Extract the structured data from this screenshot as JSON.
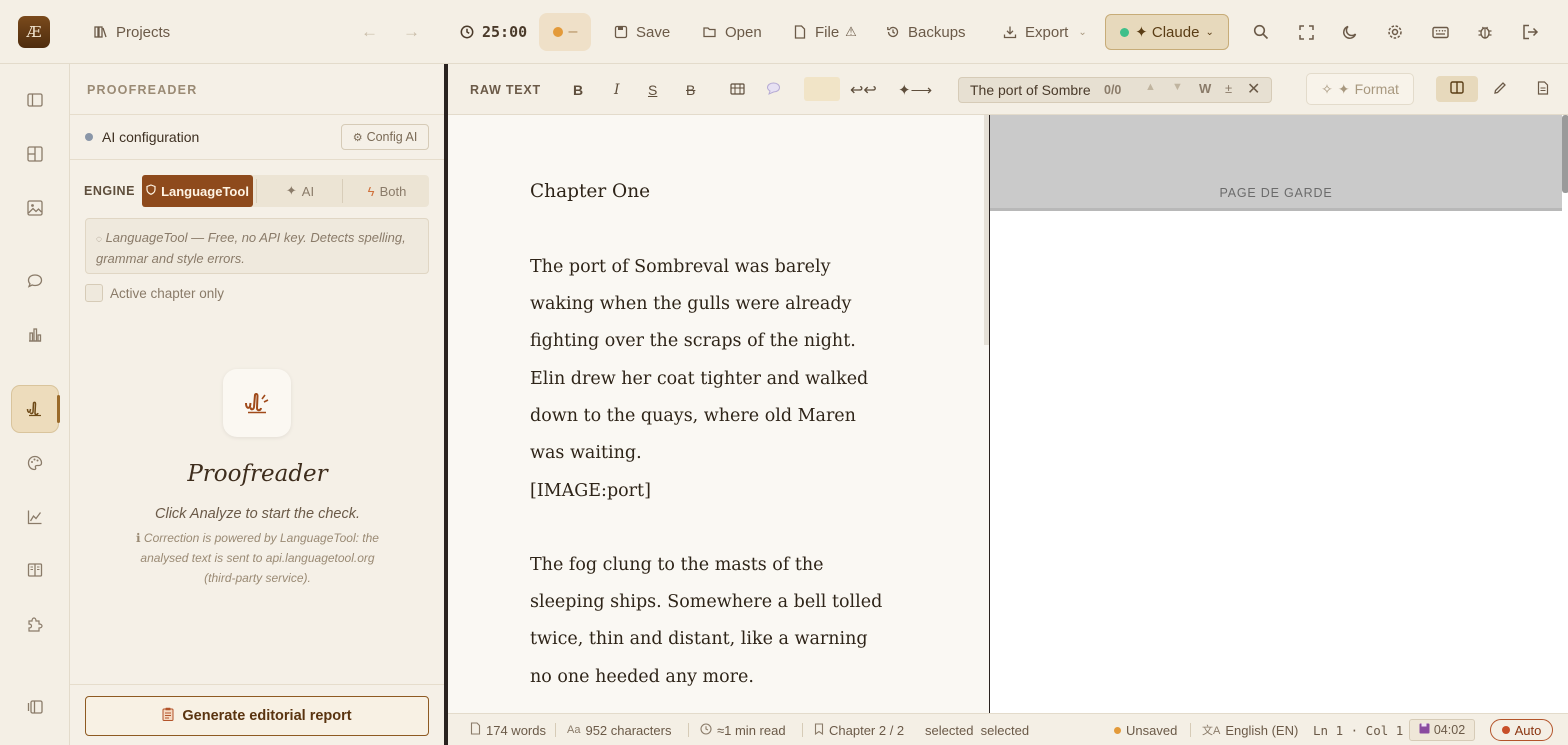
{
  "app": {
    "logo": "Æ"
  },
  "topbar": {
    "projects_label": "Projects",
    "timer": "25:00",
    "pomodoro_state": "–",
    "save_label": "Save",
    "open_label": "Open",
    "file_label": "File",
    "file_warning": "⚠",
    "backups_label": "Backups",
    "export_label": "Export",
    "model_label": "✦ Claude",
    "icons": [
      "search-icon",
      "fullscreen-icon",
      "moon-icon",
      "settings-icon",
      "keyboard-icon",
      "bug-icon",
      "logout-icon"
    ]
  },
  "sidebar_rail": {
    "icons": [
      "sidebar-toggle-icon",
      "grid-icon",
      "image-icon",
      "chat-icon",
      "bar-chart-icon",
      "proofreader-icon",
      "palette-icon",
      "analytics-icon",
      "book-icon",
      "puzzle-icon",
      "collapse-icon"
    ],
    "active": "proofreader-icon"
  },
  "proofreader": {
    "title": "PROOFREADER",
    "ai_config_label": "AI configuration",
    "config_button": "Config AI",
    "engine_label": "ENGINE",
    "engines": [
      "LanguageTool",
      "AI",
      "Both"
    ],
    "engine_selected": "LanguageTool",
    "engine_note": "LanguageTool — Free, no API key. Detects spelling, grammar and style errors.",
    "active_chapter_label": "Active chapter only",
    "active_chapter_checked": false,
    "heading": "Proofreader",
    "subtext": "Click Analyze to start the check.",
    "privacy_note": "Correction is powered by LanguageTool: the analysed text is sent to api.languagetool.org (third-party service).",
    "report_button": "Generate editorial report"
  },
  "editor_toolbar": {
    "mode_label": "RAW TEXT",
    "bold": "B",
    "italic": "I",
    "underline": "S",
    "strike": "B",
    "search_value": "The port of Sombre",
    "search_count": "0/0",
    "whole_word": "W",
    "case_toggle": "±",
    "format_label": "Format"
  },
  "document": {
    "chapter_title": "Chapter One",
    "paragraph_1": "The port of Sombreval was barely waking when the gulls were already fighting over the scraps of the night. Elin drew her coat tighter and walked down to the quays, where old Maren was waiting.",
    "image_tag": "[IMAGE:port]",
    "paragraph_2": "The fog clung to the masts of the sleeping ships. Somewhere a bell tolled twice, thin and distant, like a warning no one heeded any more."
  },
  "preview": {
    "page_label": "PAGE DE GARDE"
  },
  "statusbar": {
    "words": "174 words",
    "characters": "952 characters",
    "read_time": "≈1 min read",
    "chapter": "Chapter 2 / 2",
    "selection": "selected  selected",
    "save_state": "Unsaved",
    "language": "English (EN)",
    "position": "Ln 1 · Col 1",
    "time": "04:02",
    "auto_label": "Auto"
  },
  "colors": {
    "accent": "#8e4a1c",
    "background": "#f3efe6",
    "status_unsaved": "#e39a3a",
    "status_ok": "#3fbf8a"
  }
}
